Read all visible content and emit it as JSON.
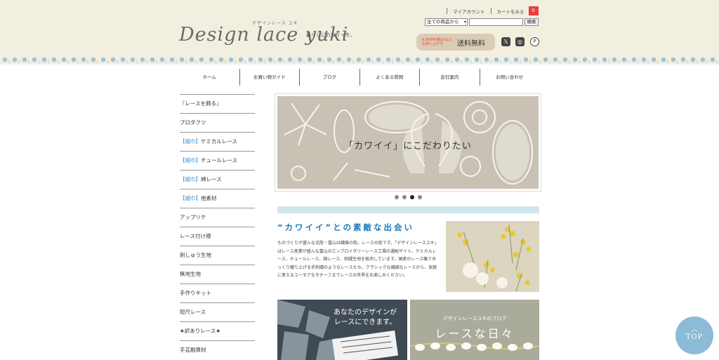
{
  "header": {
    "logo_small": "デザインレース ユキ",
    "logo_main": "Design lace yuki",
    "tagline": "暮らしにカワイイを。",
    "top_links": [
      "マイアカウント",
      "カートをみる"
    ],
    "cart_count": "0",
    "search": {
      "category_selected": "全ての商品から",
      "button_label": "検索"
    },
    "shipping": {
      "small_text": "6,000円(税込)以上お買い上げで",
      "big_text": "送料無料"
    },
    "social_icons": [
      "x-icon",
      "instagram-icon",
      "pinterest-icon"
    ]
  },
  "global_nav": [
    "ホーム",
    "お買い物ガイド",
    "ブログ",
    "よくある質問",
    "会社案内",
    "お問い合わせ"
  ],
  "sidebar": {
    "items": [
      {
        "prefix": "",
        "label": "『レースを飾る』"
      },
      {
        "prefix": "",
        "label": "プロダクツ"
      },
      {
        "prefix": "【細巾】",
        "label": "ケミカルレース"
      },
      {
        "prefix": "【細巾】",
        "label": "チュールレース"
      },
      {
        "prefix": "【細巾】",
        "label": "綿レース"
      },
      {
        "prefix": "【細巾】",
        "label": "他素材"
      },
      {
        "prefix": "",
        "label": "アップリケ"
      },
      {
        "prefix": "",
        "label": "レース付け襟"
      },
      {
        "prefix": "",
        "label": "刺しゅう生地"
      },
      {
        "prefix": "",
        "label": "無地生地"
      },
      {
        "prefix": "",
        "label": "手作りキット"
      },
      {
        "prefix": "",
        "label": "短尺レース"
      },
      {
        "prefix": "",
        "label": "★訳ありレース★"
      },
      {
        "prefix": "",
        "label": "手芸副資材"
      }
    ]
  },
  "slider": {
    "caption": "「カワイイ」にこだわりたい",
    "dot_count": 4,
    "active_dot": 3
  },
  "intro": {
    "title": "“カワイイ”との素敵な出会い",
    "text": "ものづくりが盛んな北陸・富山は繊維の街。レースの街です。「デザインレースユキ」はレース産業が盛んな富山のエンブロイダリーレース工場の通販サイト。ケミカルレース、チュールレース、綿レース、刺繍生地を販売しています。国産のレース機でゆっくり織り上げる手刺繍のようなレースたち。クラシックな繊細なレースから、気軽に使えるユーモアなモチーフまでレースの世界をお楽しみください。"
  },
  "banners": {
    "design": {
      "line1": "あなたのデザインが",
      "line2": "レースにできます。"
    },
    "blog": {
      "subtitle": "デザインレースユキのブログ",
      "title": "レースな日々"
    }
  },
  "top_button": {
    "label": "TOP"
  },
  "colors": {
    "header_bg": "#f3efe0",
    "accent_blue": "#1f7cb8",
    "cart_red": "#e83e3e",
    "top_button": "#8bbbd7"
  }
}
